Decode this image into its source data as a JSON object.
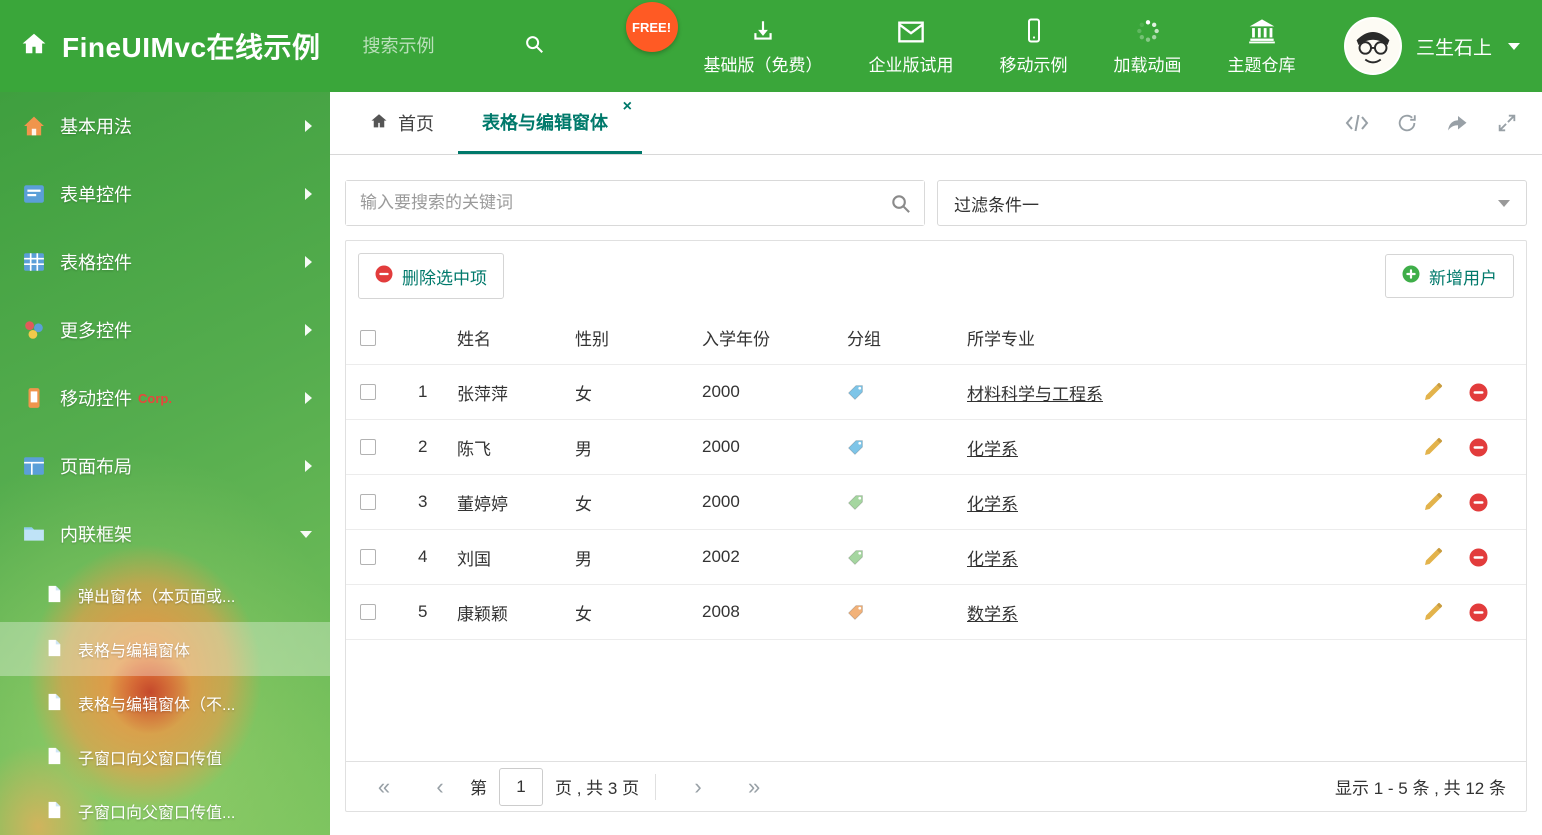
{
  "colors": {
    "brand-green": "#3aa63a",
    "accent-teal": "#00796b",
    "free-orange": "#ff5a24",
    "danger-red": "#e23c3c",
    "success-green": "#3fae49",
    "pencil-yellow": "#e3b34b"
  },
  "header": {
    "title": "FineUIMvc在线示例",
    "search_placeholder": "搜索示例",
    "free_badge": "FREE!",
    "nav_items": [
      {
        "label": "基础版（免费）",
        "icon": "download-icon"
      },
      {
        "label": "企业版试用",
        "icon": "envelope-icon"
      },
      {
        "label": "移动示例",
        "icon": "mobile-icon"
      },
      {
        "label": "加载动画",
        "icon": "spinner-icon"
      },
      {
        "label": "主题仓库",
        "icon": "bank-icon"
      }
    ],
    "user": {
      "name": "三生石上",
      "avatar": "cartoon-face-avatar",
      "caret": "chevron-down-icon"
    }
  },
  "sidebar": {
    "items": [
      {
        "label": "基本用法",
        "icon": "home-icon"
      },
      {
        "label": "表单控件",
        "icon": "form-icon"
      },
      {
        "label": "表格控件",
        "icon": "table-icon"
      },
      {
        "label": "更多控件",
        "icon": "widgets-icon"
      },
      {
        "label": "移动控件",
        "icon": "mobile-icon",
        "badge": "Corp."
      },
      {
        "label": "页面布局",
        "icon": "layout-icon"
      },
      {
        "label": "内联框架",
        "icon": "iframe-icon"
      }
    ],
    "subitems": [
      {
        "label": "弹出窗体（本页面或...",
        "icon": "file-icon"
      },
      {
        "label": "表格与编辑窗体",
        "icon": "file-icon",
        "active": true
      },
      {
        "label": "表格与编辑窗体（不...",
        "icon": "file-icon"
      },
      {
        "label": "子窗口向父窗口传值",
        "icon": "file-icon"
      },
      {
        "label": "子窗口向父窗口传值...",
        "icon": "file-icon"
      }
    ]
  },
  "tabbar": {
    "home_tab": "首页",
    "active_tab": "表格与编辑窗体",
    "close": "×",
    "tools": [
      "code-icon",
      "refresh-icon",
      "share-icon",
      "expand-icon"
    ]
  },
  "filter_bar": {
    "search_placeholder": "输入要搜索的关键词",
    "filter_value": "过滤条件一"
  },
  "grid": {
    "delete_button": "删除选中项",
    "add_button": "新增用户",
    "columns": {
      "name": "姓名",
      "gender": "性别",
      "year": "入学年份",
      "group": "分组",
      "major": "所学专业"
    },
    "rows": [
      {
        "num": "1",
        "name": "张萍萍",
        "gender": "女",
        "year": "2000",
        "tag_color": "#7ec5e8",
        "major": "材料科学与工程系"
      },
      {
        "num": "2",
        "name": "陈飞",
        "gender": "男",
        "year": "2000",
        "tag_color": "#7ec5e8",
        "major": "化学系"
      },
      {
        "num": "3",
        "name": "董婷婷",
        "gender": "女",
        "year": "2000",
        "tag_color": "#a5d6a0",
        "major": "化学系"
      },
      {
        "num": "4",
        "name": "刘国",
        "gender": "男",
        "year": "2002",
        "tag_color": "#a5d6a0",
        "major": "化学系"
      },
      {
        "num": "5",
        "name": "康颖颖",
        "gender": "女",
        "year": "2008",
        "tag_color": "#f2b279",
        "major": "数学系"
      }
    ]
  },
  "pagination": {
    "first": "«",
    "prev": "‹",
    "page_label_before": "第",
    "current_page": "1",
    "page_label_after": "页 , 共 3 页",
    "next": "›",
    "last": "»",
    "summary": "显示 1 - 5 条 , 共 12 条"
  }
}
